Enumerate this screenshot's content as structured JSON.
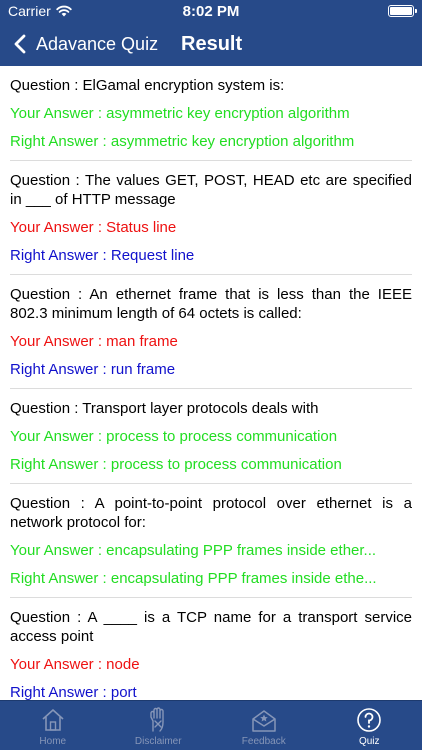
{
  "status_bar": {
    "carrier": "Carrier",
    "time": "8:02 PM"
  },
  "nav": {
    "back_label": "Adavance Quiz",
    "title": "Result"
  },
  "results": [
    {
      "question": "Question : ElGamal encryption system is:",
      "your_answer": "Your Answer : asymmetric key encryption algorithm",
      "right_answer": "Right Answer : asymmetric key encryption algorithm",
      "correct": true
    },
    {
      "question": "Question : The values GET, POST, HEAD etc are specified in ___ of HTTP message",
      "your_answer": "Your Answer : Status line",
      "right_answer": "Right Answer : Request line",
      "correct": false
    },
    {
      "question": "Question : An ethernet frame that is less than the IEEE 802.3 minimum length of 64 octets is called:",
      "your_answer": "Your Answer : man frame",
      "right_answer": "Right Answer : run frame",
      "correct": false
    },
    {
      "question": "Question : Transport layer protocols deals with",
      "your_answer": "Your Answer : process to process communication",
      "right_answer": "Right Answer : process to process communication",
      "correct": true
    },
    {
      "question": "Question : A point-to-point protocol over ethernet is a network protocol for:",
      "your_answer": "Your Answer : encapsulating PPP frames inside ether...",
      "right_answer": "Right Answer : encapsulating PPP frames inside ethe...",
      "correct": true
    },
    {
      "question": "Question : A ____ is a TCP name for a transport service access point",
      "your_answer": "Your Answer : node",
      "right_answer": "Right Answer : port",
      "correct": false
    }
  ],
  "tabs": [
    {
      "label": "Home",
      "icon": "home-icon",
      "active": false
    },
    {
      "label": "Disclaimer",
      "icon": "disclaimer-icon",
      "active": false
    },
    {
      "label": "Feedback",
      "icon": "feedback-icon",
      "active": false
    },
    {
      "label": "Quiz",
      "icon": "question-icon",
      "active": true
    }
  ],
  "colors": {
    "bar_background": "#274a89",
    "correct_answer": "#22dd22",
    "wrong_answer": "#ee1111",
    "right_answer_when_wrong": "#1111cc",
    "tab_inactive": "#8696b8",
    "tab_active": "#ffffff"
  }
}
